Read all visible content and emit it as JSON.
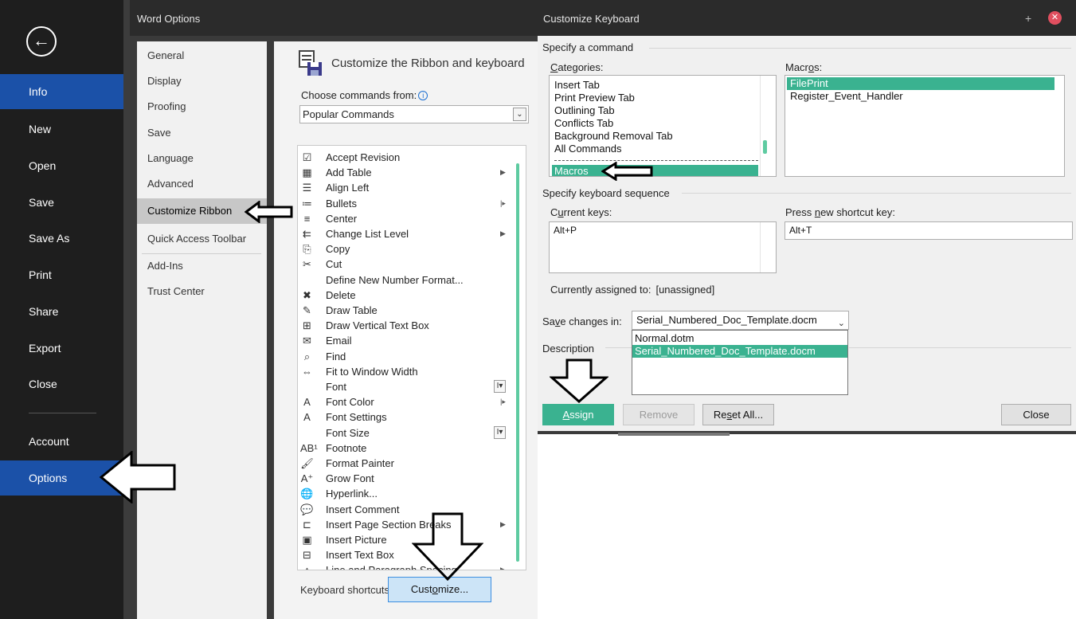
{
  "backstage": {
    "back_label": "←",
    "items": [
      {
        "label": "Info"
      },
      {
        "label": "New"
      },
      {
        "label": "Open"
      },
      {
        "label": "Save"
      },
      {
        "label": "Save As"
      },
      {
        "label": "Print"
      },
      {
        "label": "Share"
      },
      {
        "label": "Export"
      },
      {
        "label": "Close"
      },
      {
        "label": "Account"
      },
      {
        "label": "Options"
      }
    ]
  },
  "word_options": {
    "title": "Word Options",
    "nav": [
      "General",
      "Display",
      "Proofing",
      "Save",
      "Language",
      "Advanced",
      "Customize Ribbon",
      "Quick Access Toolbar",
      "Add-Ins",
      "Trust Center"
    ],
    "section_title": "Customize the Ribbon and keyboard",
    "choose_prefix": "Choose commands from:",
    "choose_value": "Popular Commands",
    "commands": [
      {
        "label": "Accept Revision",
        "icon": "☑"
      },
      {
        "label": "Add Table",
        "icon": "▦",
        "sub": "▶"
      },
      {
        "label": "Align Left",
        "icon": "☰"
      },
      {
        "label": "Bullets",
        "icon": "≔",
        "sub": "|▸"
      },
      {
        "label": "Center",
        "icon": "≡"
      },
      {
        "label": "Change List Level",
        "icon": "⇇",
        "sub": "▶"
      },
      {
        "label": "Copy",
        "icon": "⎘"
      },
      {
        "label": "Cut",
        "icon": "✂"
      },
      {
        "label": "Define New Number Format...",
        "icon": ""
      },
      {
        "label": "Delete",
        "icon": "✖"
      },
      {
        "label": "Draw Table",
        "icon": "✎"
      },
      {
        "label": "Draw Vertical Text Box",
        "icon": "⊞"
      },
      {
        "label": "Email",
        "icon": "✉"
      },
      {
        "label": "Find",
        "icon": "⌕"
      },
      {
        "label": "Fit to Window Width",
        "icon": "⇔"
      },
      {
        "label": "Font",
        "icon": "",
        "box": "I▾"
      },
      {
        "label": "Font Color",
        "icon": "A",
        "sub": "|▸"
      },
      {
        "label": "Font Settings",
        "icon": "A"
      },
      {
        "label": "Font Size",
        "icon": "",
        "box": "I▾"
      },
      {
        "label": "Footnote",
        "icon": "AB¹"
      },
      {
        "label": "Format Painter",
        "icon": "🖌"
      },
      {
        "label": "Grow Font",
        "icon": "A⁺"
      },
      {
        "label": "Hyperlink...",
        "icon": "🌐"
      },
      {
        "label": "Insert Comment",
        "icon": "💬"
      },
      {
        "label": "Insert Page  Section Breaks",
        "icon": "⊏",
        "sub": "▶"
      },
      {
        "label": "Insert Picture",
        "icon": "▣"
      },
      {
        "label": "Insert Text Box",
        "icon": "⊟"
      },
      {
        "label": "Line and Paragraph Spacing",
        "icon": "↕",
        "sub": "▶"
      }
    ],
    "keyboard_shortcuts_label": "Keyboard shortcuts:",
    "customize_button": {
      "pre": "Cust",
      "u": "o",
      "post": "mize..."
    }
  },
  "customize_keyboard": {
    "title": "Customize Keyboard",
    "plus_label": "+",
    "close_label": "✕",
    "specify_command": "Specify a command",
    "categories_label": {
      "u": "C",
      "rest": "ategories:"
    },
    "categories": [
      "Insert Tab",
      "Print Preview Tab",
      "Outlining Tab",
      "Conflicts Tab",
      "Background Removal Tab",
      "All Commands"
    ],
    "selected_category": "Macros",
    "macros_label": {
      "pre": "Macr",
      "u": "o",
      "post": "s:"
    },
    "macros": [
      "FilePrint",
      "Register_Event_Handler"
    ],
    "specify_sequence": "Specify keyboard sequence",
    "current_keys_label": {
      "pre": "C",
      "u": "u",
      "post": "rrent keys:"
    },
    "current_keys": [
      "Alt+P"
    ],
    "press_new_label": {
      "pre": "Press ",
      "u": "n",
      "post": "ew shortcut key:"
    },
    "new_key_value": "Alt+T",
    "currently_assigned_label": "Currently assigned to:",
    "currently_assigned_value": "[unassigned]",
    "save_changes_label": {
      "pre": "Sa",
      "u": "v",
      "post": "e changes in:"
    },
    "save_changes_value": "Serial_Numbered_Doc_Template.docm",
    "save_options": [
      "Normal.dotm",
      "Serial_Numbered_Doc_Template.docm"
    ],
    "description_label": "Description",
    "buttons": {
      "assign": {
        "u": "A",
        "rest": "ssign"
      },
      "remove": "Remove",
      "reset_all": {
        "pre": "Re",
        "u": "s",
        "post": "et All..."
      },
      "close": "Close"
    }
  },
  "colors": {
    "accent_teal": "#3ab290",
    "backstage_active": "#1b51a8",
    "backstage_bg": "#1e1e1e",
    "titlebar": "#2b2b2b"
  }
}
